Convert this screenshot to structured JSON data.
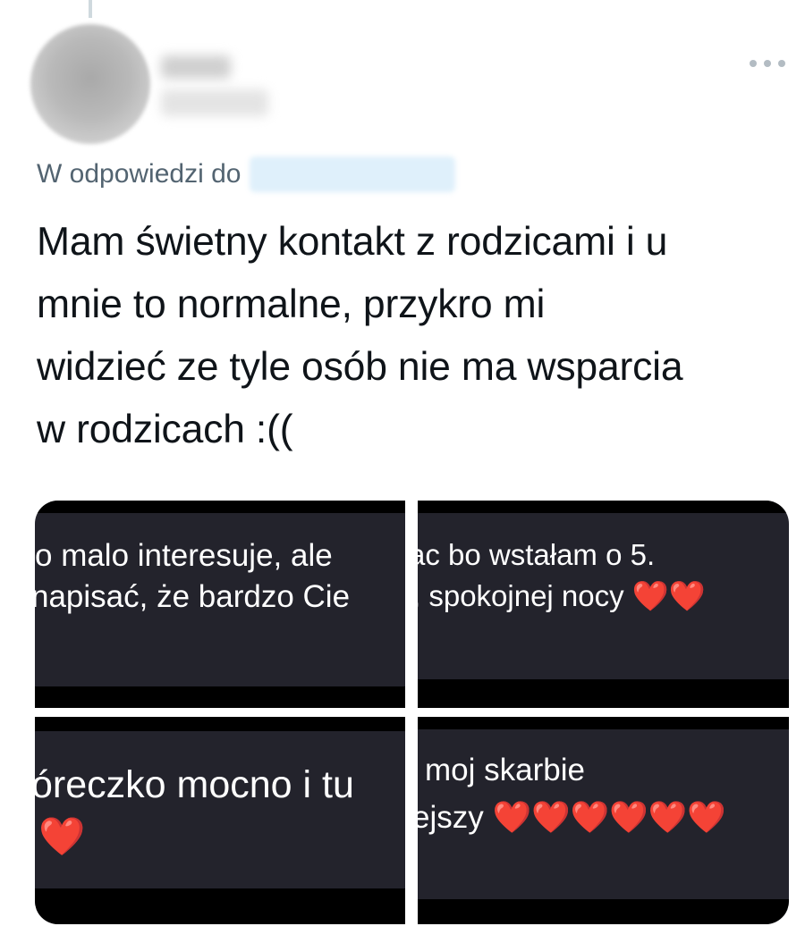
{
  "tweet": {
    "reply_prefix": "W odpowiedzi do",
    "text": "Mam świetny kontakt z rodzicami i u\nmnie to normalne, przykro mi\nwidzieć ze tyle osób nie ma wsparcia\nw rodzicach :(("
  },
  "media": {
    "tiles": [
      {
        "lines": [
          "o malo interesuje, ale",
          "napisać, że bardzo Cie"
        ]
      },
      {
        "lines": [
          "ac bo wstałam o 5.",
          ", spokojnej nocy ❤️❤️"
        ]
      },
      {
        "lines": [
          "óreczko mocno i tu",
          "❤️"
        ]
      },
      {
        "lines": [
          "moj skarbie",
          "ejszy ❤️❤️❤️❤️❤️❤️"
        ]
      }
    ]
  },
  "icons": {
    "more": "more-horizontal-icon",
    "heart": "red-heart-emoji"
  },
  "colors": {
    "text": "#0f1419",
    "secondary": "#536471",
    "chat_background": "#23232c",
    "heart": "#e0262b"
  }
}
